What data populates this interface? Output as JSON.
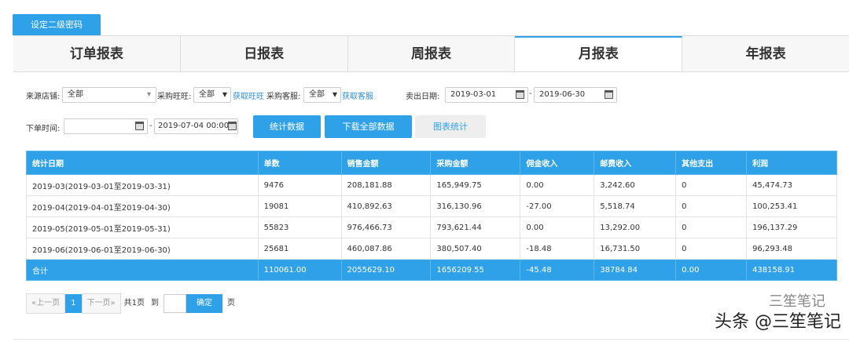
{
  "top_button": "设定二级密码",
  "tabs": [
    "订单报表",
    "日报表",
    "周报表",
    "月报表",
    "年报表"
  ],
  "active_tab": "月报表",
  "filters": {
    "source_shop_label": "来源店铺:",
    "source_shop_value": "全部",
    "wangwang_label": "采购旺旺:",
    "wangwang_value": "全部",
    "get_wangwang": "获取旺旺",
    "service_label": "采购客服:",
    "service_value": "全部",
    "get_service": "获取客服",
    "sell_date_label": "卖出日期:",
    "sell_date_from": "2019-03-01",
    "sell_date_to": "2019-06-30",
    "order_time_label": "下单时间:",
    "order_time_from": "",
    "order_time_to": "2019-07-04 00:00",
    "dash": "-"
  },
  "buttons": {
    "stats": "统计数据",
    "download": "下载全部数据",
    "chart": "图表统计"
  },
  "table": {
    "headers": [
      "统计日期",
      "单数",
      "销售金额",
      "采购金额",
      "佣金收入",
      "邮费收入",
      "其他支出",
      "利润"
    ],
    "rows": [
      [
        "2019-03(2019-03-01至2019-03-31)",
        "9476",
        "208,181.88",
        "165,949.75",
        "0.00",
        "3,242.60",
        "0",
        "45,474.73"
      ],
      [
        "2019-04(2019-04-01至2019-04-30)",
        "19081",
        "410,892.63",
        "316,130.96",
        "-27.00",
        "5,518.74",
        "0",
        "100,253.41"
      ],
      [
        "2019-05(2019-05-01至2019-05-31)",
        "55823",
        "976,466.73",
        "793,621.44",
        "0.00",
        "13,292.00",
        "0",
        "196,137.29"
      ],
      [
        "2019-06(2019-06-01至2019-06-30)",
        "25681",
        "460,087.86",
        "380,507.40",
        "-18.48",
        "16,731.50",
        "0",
        "96,293.48"
      ]
    ],
    "total": [
      "合计",
      "110061.00",
      "2055629.10",
      "1656209.55",
      "-45.48",
      "38784.84",
      "0.00",
      "438158.91"
    ]
  },
  "pagination": {
    "prev": "«上一页",
    "current": "1",
    "next": "下一页»",
    "total": "共1页",
    "goto": "到",
    "confirm": "确定",
    "page_suffix": "页"
  },
  "watermark": {
    "line1": "三笙笔记",
    "line2": "头条 @三笙笔记"
  }
}
